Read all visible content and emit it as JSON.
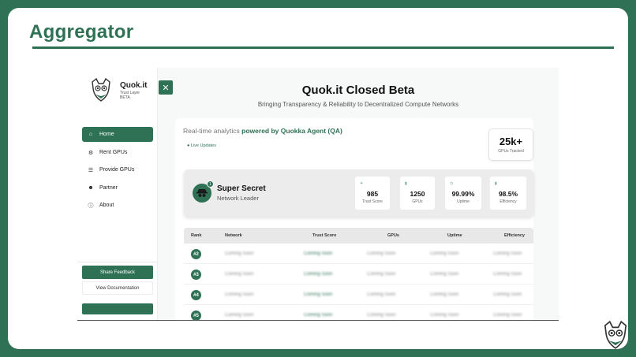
{
  "slide": {
    "title": "Aggregator"
  },
  "sidebar": {
    "brand": {
      "name": "Quok.it",
      "subtitle": "Trust Layer",
      "badge": "BETA"
    },
    "items": [
      {
        "label": "Home",
        "icon": "home-icon",
        "active": true
      },
      {
        "label": "Rent GPUs",
        "icon": "gpu-icon",
        "active": false
      },
      {
        "label": "Provide GPUs",
        "icon": "server-icon",
        "active": false
      },
      {
        "label": "Partner",
        "icon": "users-icon",
        "active": false
      },
      {
        "label": "About",
        "icon": "info-icon",
        "active": false
      }
    ],
    "feedback_label": "Share Feedback",
    "docs_label": "View Documentation"
  },
  "main": {
    "title": "Quok.it Closed Beta",
    "subtitle": "Bringing Transparency & Reliability to Decentralized Compute Networks",
    "analytics_prefix": "Real-time analytics ",
    "analytics_highlight": "powered by Quokka Agent (QA)",
    "live_label": "Live Updates",
    "tracked": {
      "value": "25k+",
      "label": "GPUs Tracked"
    }
  },
  "leader": {
    "rank_badge": "1",
    "name": "Super Secret",
    "role": "Network Leader",
    "stats": [
      {
        "value": "985",
        "label": "Trust Score"
      },
      {
        "value": "1250",
        "label": "GPUs"
      },
      {
        "value": "99.99%",
        "label": "Uptime"
      },
      {
        "value": "98.5%",
        "label": "Efficiency"
      }
    ]
  },
  "table": {
    "headers": [
      "Rank",
      "Network",
      "Trust Score",
      "GPUs",
      "Uptime",
      "Efficiency"
    ],
    "rows": [
      {
        "rank": "#2",
        "cells": [
          "Coming Soon",
          "Coming Soon",
          "Coming Soon",
          "Coming Soon",
          "Coming Soon"
        ]
      },
      {
        "rank": "#3",
        "cells": [
          "Coming Soon",
          "Coming Soon",
          "Coming Soon",
          "Coming Soon",
          "Coming Soon"
        ]
      },
      {
        "rank": "#4",
        "cells": [
          "Coming Soon",
          "Coming Soon",
          "Coming Soon",
          "Coming Soon",
          "Coming Soon"
        ]
      },
      {
        "rank": "#5",
        "cells": [
          "Coming Soon",
          "Coming Soon",
          "Coming Soon",
          "Coming Soon",
          "Coming Soon"
        ]
      }
    ]
  },
  "colors": {
    "brand_green": "#2e7155",
    "background": "#ffffff"
  }
}
